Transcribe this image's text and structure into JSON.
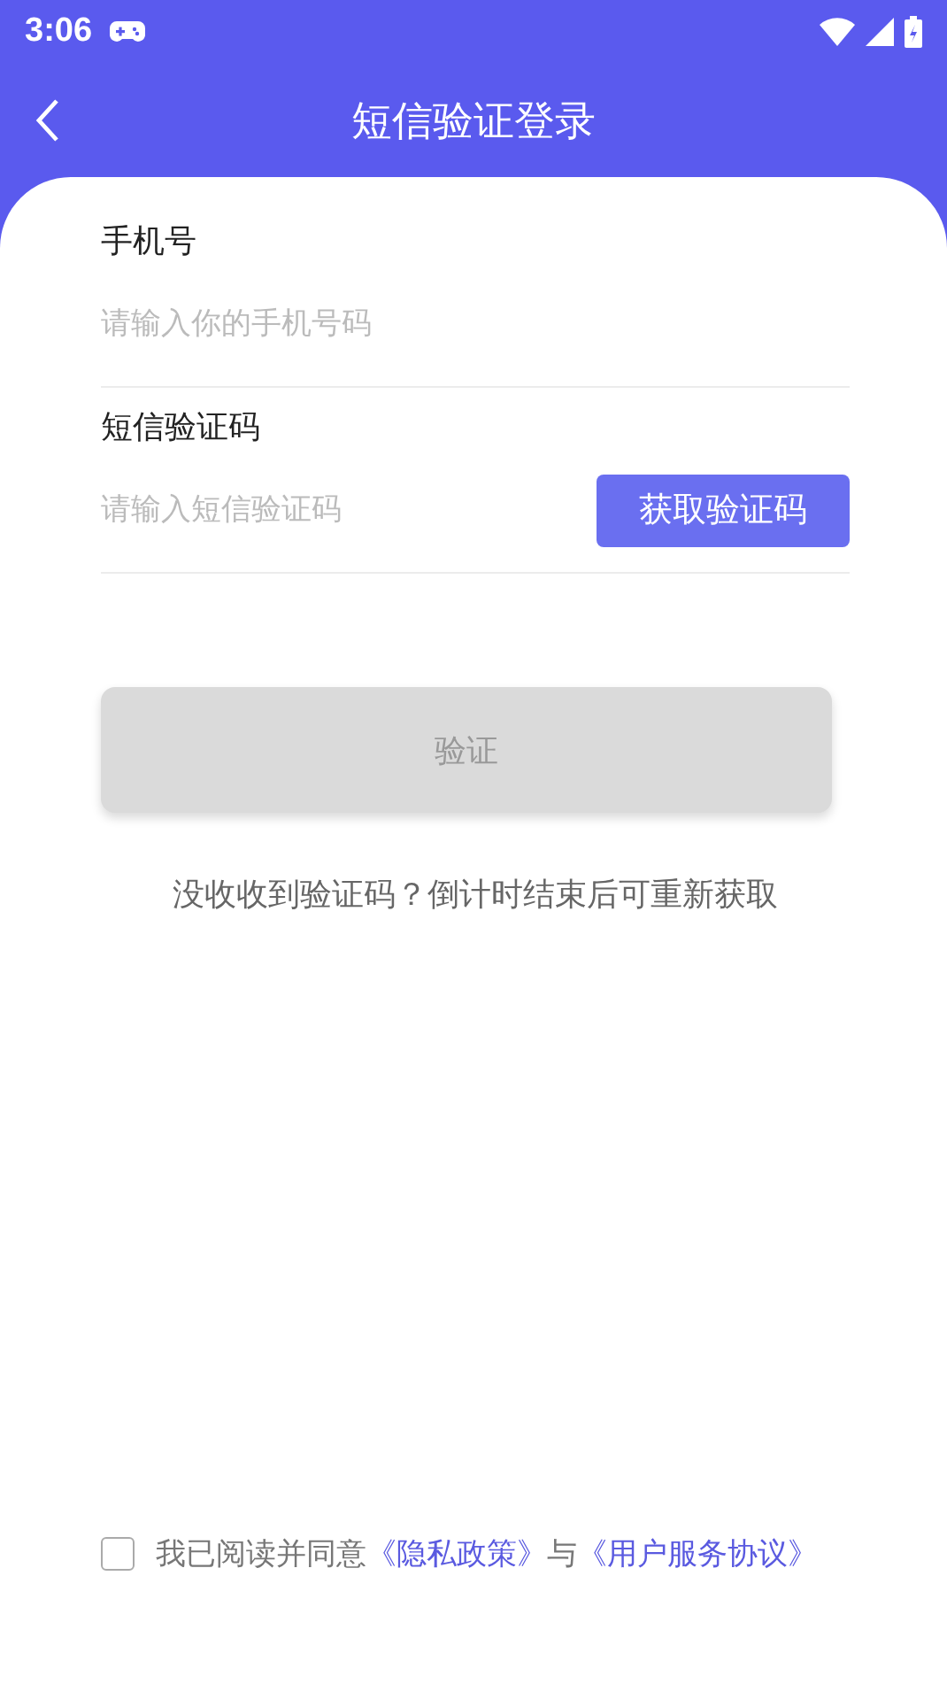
{
  "status_bar": {
    "time": "3:06"
  },
  "header": {
    "title": "短信验证登录"
  },
  "fields": [
    {
      "label": "手机号",
      "placeholder": "请输入你的手机号码"
    },
    {
      "label": "短信验证码",
      "placeholder": "请输入短信验证码",
      "action": "获取验证码"
    }
  ],
  "submit": {
    "label": "验证",
    "disabled": true
  },
  "hint": "没收收到验证码？倒计时结束后可重新获取",
  "agreement": {
    "checked": false,
    "text": "我已阅读并同意",
    "links": [
      "《隐私政策》",
      "《用户服务协议》"
    ],
    "joiner": "与"
  }
}
